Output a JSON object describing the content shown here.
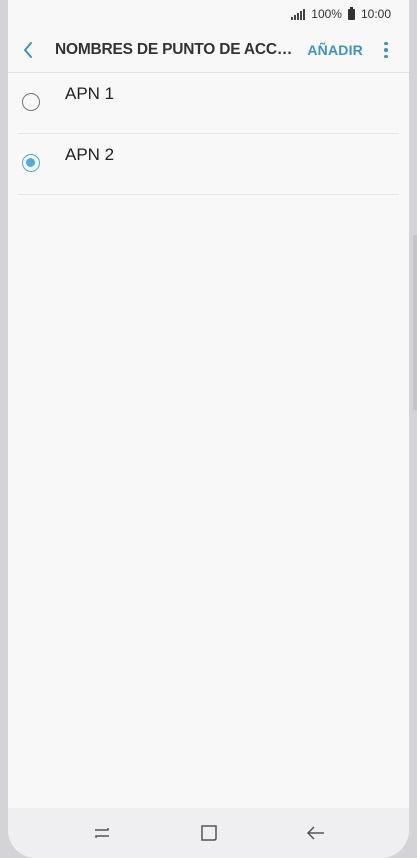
{
  "status_bar": {
    "battery": "100%",
    "time": "10:00"
  },
  "app_bar": {
    "title": "NOMBRES DE PUNTO DE ACC…",
    "add_label": "AÑADIR"
  },
  "apn_list": [
    {
      "label": "APN 1",
      "selected": false
    },
    {
      "label": "APN 2",
      "selected": true
    }
  ],
  "icons": {
    "back": "back-arrow-icon",
    "more": "more-vertical-icon",
    "recents": "recents-icon",
    "home": "home-icon",
    "nav_back": "back-icon",
    "signal": "signal-icon",
    "battery": "battery-icon"
  },
  "colors": {
    "accent": "#3f93c0",
    "radio_selected": "#4aaee0",
    "background": "#f8f8f8"
  }
}
